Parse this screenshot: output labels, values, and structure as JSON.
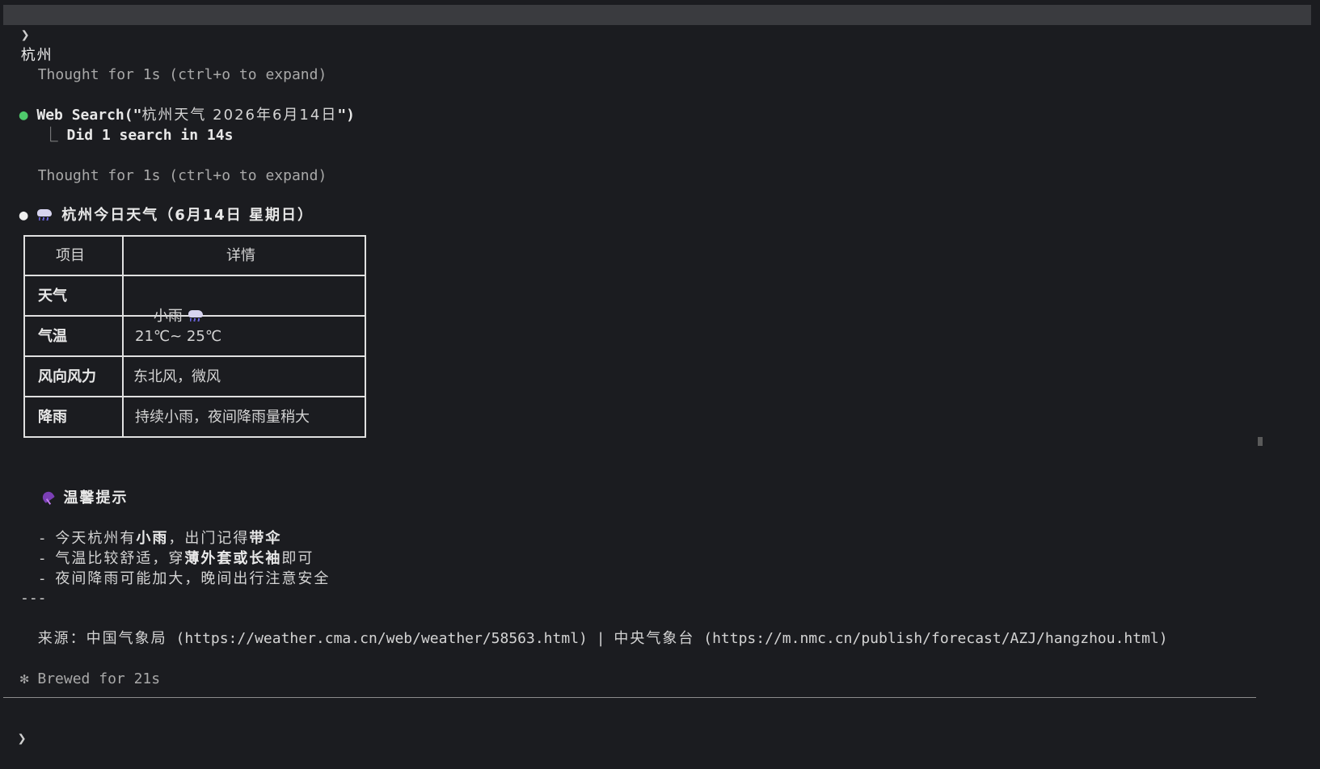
{
  "user_prompt": {
    "glyph": "❯",
    "text": "杭州"
  },
  "thought_1": "Thought for 1s (ctrl+o to expand)",
  "tool_call": {
    "bullet": "●",
    "name": "Web Search",
    "open": "(\"",
    "query": "杭州天气 2026年6月14日",
    "close": "\")",
    "result_prefix": "⎿",
    "result": "Did 1 search in 14s"
  },
  "thought_2": "Thought for 1s (ctrl+o to expand)",
  "answer": {
    "bullet": "●",
    "heading_icon": "cloud-with-rain-icon",
    "heading": "杭州今日天气（6月14日 星期日）",
    "table": {
      "headers": [
        "项目",
        "详情"
      ],
      "rows": [
        [
          "天气",
          "小雨"
        ],
        [
          "气温",
          "21℃~ 25℃"
        ],
        [
          "风向风力",
          "东北风，微风"
        ],
        [
          "降雨",
          "持续小雨，夜间降雨量稍大"
        ]
      ]
    },
    "tips_icon": "umbrella-icon",
    "tips_heading": "温馨提示",
    "tips": [
      {
        "prefix": "- ",
        "a": "今天杭州有",
        "b": "小雨",
        "c": "，出门记得",
        "d": "带伞",
        "e": ""
      },
      {
        "prefix": "- ",
        "a": "气温比较舒适，穿",
        "b": "薄外套或长袖",
        "c": "即可",
        "d": "",
        "e": ""
      },
      {
        "prefix": "- ",
        "a": "夜间降雨可能加大，晚间出行注意安全",
        "b": "",
        "c": "",
        "d": "",
        "e": ""
      }
    ],
    "divider": "---",
    "source_label": "来源：中国气象局",
    "source_url_1": "(https://weather.cma.cn/web/weather/58563.html)",
    "source_sep": "|",
    "source_label_2": "中央气象台",
    "source_url_2": "(https://m.nmc.cn/publish/forecast/AZJ/hangzhou.html)"
  },
  "status": {
    "glyph": "✻",
    "text": "Brewed for 21s"
  },
  "input": {
    "glyph": "❯",
    "value": ""
  },
  "colors": {
    "background": "#1b1c20",
    "user_bar": "#3a3b3f",
    "tool_bullet": "#4ec96b",
    "answer_bullet": "#f0f0f0",
    "dim_text": "#a9a9a9"
  }
}
